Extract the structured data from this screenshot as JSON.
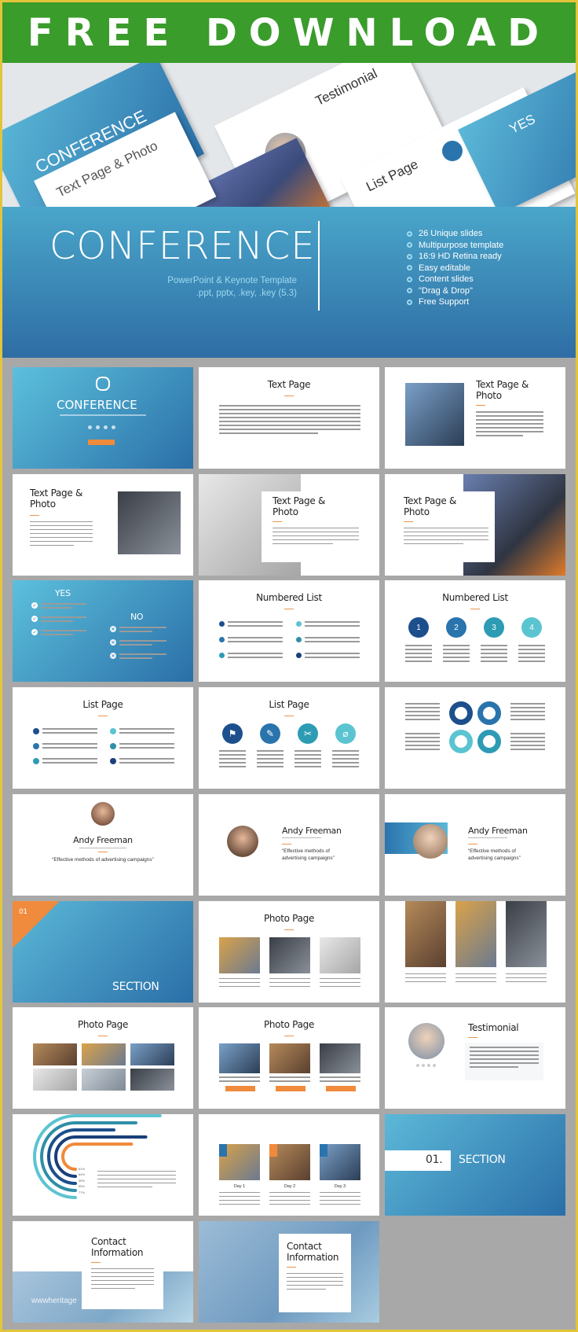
{
  "banner": {
    "title": "FREE DOWNLOAD"
  },
  "hero": {
    "title": "CONFERENCE",
    "subtitle_line1": "PowerPoint & Keynote Template",
    "subtitle_line2": ".ppt, pptx, .key, .key (5.3)",
    "features": [
      "26 Unique slides",
      "Multipurpose template",
      "16:9 HD Retina ready",
      "Easy editable",
      "Content slides",
      "\"Drag & Drop\"",
      "Free Support"
    ],
    "preview_labels": {
      "cover": "CONFERENCE",
      "testimonial": "Testimonial",
      "list": "List Page",
      "textphoto": "Text Page & Photo",
      "yes": "YES"
    }
  },
  "colors": {
    "banner": "#3a9c2b",
    "frame": "#e3c43a",
    "background": "#a8a8a8",
    "accent_orange": "#f08a3c",
    "blue_dark": "#1c4f8c",
    "blue": "#2a74ad",
    "teal": "#2e9bb5",
    "teal_light": "#5bc4d1"
  },
  "slides": [
    {
      "type": "cover",
      "title": "CONFERENCE"
    },
    {
      "type": "text",
      "title": "Text Page"
    },
    {
      "type": "tp-left",
      "title1": "Text Page &",
      "title2": "Photo"
    },
    {
      "type": "tp-right",
      "title1": "Text Page &",
      "title2": "Photo"
    },
    {
      "type": "tp-bgleft",
      "title1": "Text Page &",
      "title2": "Photo"
    },
    {
      "type": "tp-bgright",
      "title1": "Text Page &",
      "title2": "Photo"
    },
    {
      "type": "yesno",
      "yes": "YES",
      "no": "NO"
    },
    {
      "type": "numlist",
      "title": "Numbered List"
    },
    {
      "type": "numcircles",
      "title": "Numbered List",
      "numbers": [
        "1",
        "2",
        "3",
        "4"
      ]
    },
    {
      "type": "listpage",
      "title": "List Page"
    },
    {
      "type": "iconcircles",
      "title": "List Page",
      "icons": [
        "flag-icon",
        "pencil-icon",
        "scissors-icon",
        "paperclip-icon"
      ]
    },
    {
      "type": "clover"
    },
    {
      "type": "profile-center",
      "name": "Andy Freeman",
      "quote": "“Effective methods of advertising campaigns”"
    },
    {
      "type": "profile-left",
      "name": "Andy Freeman",
      "quote1": "“Effective methods of",
      "quote2": "advertising campaigns”"
    },
    {
      "type": "profile-band",
      "name": "Andy Freeman",
      "quote1": "“Effective methods of",
      "quote2": "advertising campaigns”"
    },
    {
      "type": "section",
      "number": "01",
      "title": "SECTION"
    },
    {
      "type": "photopage",
      "title": "Photo Page"
    },
    {
      "type": "photos3"
    },
    {
      "type": "photogrid",
      "title": "Photo Page"
    },
    {
      "type": "photobuttons",
      "title": "Photo Page"
    },
    {
      "type": "testimonial",
      "title": "Testimonial"
    },
    {
      "type": "arcs",
      "labels": [
        "51%",
        "64%",
        "35%",
        "55%",
        "77%"
      ],
      "values": [
        51,
        64,
        35,
        55,
        77
      ]
    },
    {
      "type": "days",
      "days": [
        "Day 1",
        "Day 2",
        "Day 3"
      ]
    },
    {
      "type": "section2",
      "number": "01.",
      "title": "SECTION"
    },
    {
      "type": "contact1",
      "title1": "Contact",
      "title2": "Information",
      "watermark": "wwwheritage"
    },
    {
      "type": "contact2",
      "title1": "Contact",
      "title2": "Information"
    }
  ]
}
